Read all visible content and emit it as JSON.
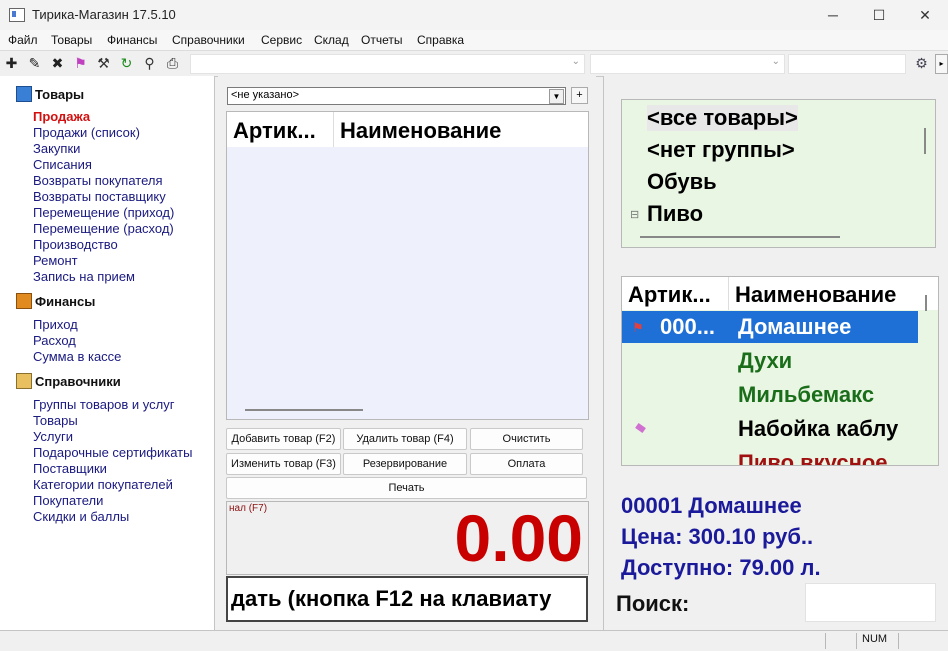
{
  "window": {
    "title": "Тирика-Магазин 17.5.10",
    "minimize": "─",
    "maximize": "☐",
    "close": "✕"
  },
  "menu": [
    "Файл",
    "Товары",
    "Финансы",
    "Справочники",
    "Сервис",
    "Склад",
    "Отчеты",
    "Справка"
  ],
  "toolbar": {
    "icons": [
      {
        "name": "add-icon",
        "glyph": "✚",
        "color": "#222222"
      },
      {
        "name": "edit-icon",
        "glyph": "✎",
        "color": "#222222"
      },
      {
        "name": "delete-icon",
        "glyph": "✖",
        "color": "#222222"
      },
      {
        "name": "flag-icon",
        "glyph": "⚑",
        "color": "#c040c0"
      },
      {
        "name": "tools-icon",
        "glyph": "⚒",
        "color": "#333333"
      },
      {
        "name": "refresh-icon",
        "glyph": "↻",
        "color": "#1e8a1e"
      },
      {
        "name": "search-icon",
        "glyph": "⚲",
        "color": "#333333"
      },
      {
        "name": "print-icon",
        "glyph": "⎙",
        "color": "#333333"
      }
    ],
    "settings_icon": "⚙"
  },
  "nav": {
    "sections": [
      {
        "title": "Товары",
        "icon": "box-icon",
        "items": [
          {
            "label": "Продажа",
            "active": true
          },
          {
            "label": "Продажи (список)"
          },
          {
            "label": "Закупки"
          },
          {
            "label": "Списания"
          },
          {
            "label": "Возвраты покупателя"
          },
          {
            "label": "Возвраты поставщику"
          },
          {
            "label": "Перемещение (приход)"
          },
          {
            "label": "Перемещение (расход)"
          },
          {
            "label": "Производство"
          },
          {
            "label": "Ремонт"
          },
          {
            "label": "Запись на прием"
          }
        ]
      },
      {
        "title": "Финансы",
        "icon": "wallet-icon",
        "items": [
          {
            "label": "Приход"
          },
          {
            "label": "Расход"
          },
          {
            "label": "Сумма в кассе"
          }
        ]
      },
      {
        "title": "Справочники",
        "icon": "books-icon",
        "items": [
          {
            "label": "Группы товаров и услуг"
          },
          {
            "label": "Товары"
          },
          {
            "label": "Услуги"
          },
          {
            "label": "Подарочные сертификаты"
          },
          {
            "label": "Поставщики"
          },
          {
            "label": "Категории покупателей"
          },
          {
            "label": "Покупатели"
          },
          {
            "label": "Скидки и баллы"
          }
        ]
      }
    ]
  },
  "sale": {
    "customer_select": "<не указано>",
    "add_customer": "+",
    "columns": [
      "Артик...",
      "Наименование"
    ],
    "buttons": {
      "add_item": "Добавить товар (F2)",
      "delete_item": "Удалить товар (F4)",
      "clear": "Очистить",
      "edit_item": "Изменить товар (F3)",
      "reserve": "Резервирование",
      "pay": "Оплата",
      "print": "Печать"
    },
    "total_label": "нал (F7)",
    "total_value": "0.00",
    "hint": "дать (кнопка F12 на клавиату"
  },
  "groups": {
    "items": [
      {
        "label": "<все товары>",
        "selected": true
      },
      {
        "label": "<нет группы>"
      },
      {
        "label": "Обувь"
      },
      {
        "label": "Пиво",
        "expander": "⊟"
      }
    ]
  },
  "products": {
    "columns": [
      "Артик...",
      "Наименование"
    ],
    "rows": [
      {
        "sku": "000...",
        "name": "Домашнее",
        "selected": true,
        "color": "#ffffff",
        "marker": "flag-icon"
      },
      {
        "sku": "",
        "name": "Духи",
        "color": "#1a6e1a"
      },
      {
        "sku": "",
        "name": "Мильбемакс",
        "color": "#1a6e1a"
      },
      {
        "sku": "",
        "name": "Набойка каблу",
        "color": "#000000",
        "marker": "eraser-icon"
      },
      {
        "sku": "",
        "name": "Пиво вкусное",
        "color": "#a01010"
      }
    ]
  },
  "selected_product": {
    "line1": "00001  Домашнее",
    "line2": "Цена: 300.10 руб..",
    "line3": "Доступно: 79.00 л."
  },
  "search": {
    "label": "Поиск:",
    "value": ""
  },
  "status": {
    "num": "NUM"
  }
}
